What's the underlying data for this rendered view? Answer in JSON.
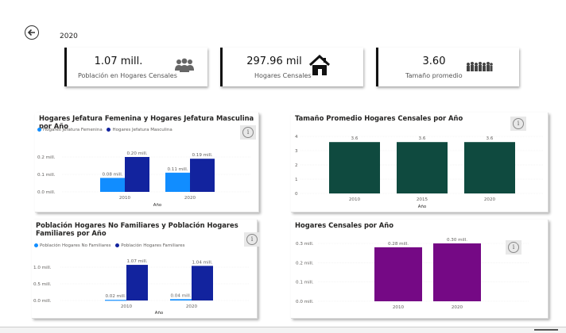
{
  "header": {
    "year": "2020"
  },
  "kpis": [
    {
      "value": "1.07 mill.",
      "label": "Población en Hogares Censales",
      "icon": "people-group-icon"
    },
    {
      "value": "297.96 mil",
      "label": "Hogares Censales",
      "icon": "house-icon"
    },
    {
      "value": "3.60",
      "label": "Tamaño promedio",
      "icon": "crowd-icon"
    }
  ],
  "chart_data": [
    {
      "type": "bar",
      "title": "Hogares Jefatura Femenina y Hogares Jefatura Masculina por Año",
      "xlabel": "Año",
      "categories": [
        "2010",
        "2020"
      ],
      "series": [
        {
          "name": "Hogares Jefatura Femenina",
          "values": [
            0.08,
            0.11
          ],
          "labels": [
            "0.08 mill.",
            "0.11 mill."
          ],
          "color": "#118dff"
        },
        {
          "name": "Hogares Jefatura Masculina",
          "values": [
            0.2,
            0.19
          ],
          "labels": [
            "0.20 mill.",
            "0.19 mill."
          ],
          "color": "#12239e"
        }
      ],
      "yticks": [
        "0.0 mill.",
        "0.1 mill.",
        "0.2 mill."
      ],
      "ylim": [
        0,
        0.2
      ]
    },
    {
      "type": "bar",
      "title": "Tamaño Promedio Hogares Censales por Año",
      "xlabel": "Año",
      "categories": [
        "2010",
        "2015",
        "2020"
      ],
      "series": [
        {
          "values": [
            3.6,
            3.6,
            3.6
          ],
          "labels": [
            "3.6",
            "3.6",
            "3.6"
          ],
          "color": "#0f4a3f"
        }
      ],
      "yticks": [
        "0",
        "1",
        "2",
        "3",
        "4"
      ],
      "ylim": [
        0,
        4
      ]
    },
    {
      "type": "bar",
      "title": "Población Hogares No Familiares y Población Hogares Familiares por Año",
      "xlabel": "Año",
      "categories": [
        "2010",
        "2020"
      ],
      "series": [
        {
          "name": "Población Hogares No Familiares",
          "values": [
            0.02,
            0.04
          ],
          "labels": [
            "0.02 mill.",
            "0.04 mill."
          ],
          "color": "#118dff"
        },
        {
          "name": "Población Hogares Familiares",
          "values": [
            1.07,
            1.04
          ],
          "labels": [
            "1.07 mill.",
            "1.04 mill."
          ],
          "color": "#12239e"
        }
      ],
      "yticks": [
        "0.0 mill.",
        "0.5 mill.",
        "1.0 mill."
      ],
      "ylim": [
        0,
        1.0
      ]
    },
    {
      "type": "bar",
      "title": "Hogares Censales por Año",
      "xlabel": "",
      "categories": [
        "2010",
        "2020"
      ],
      "series": [
        {
          "values": [
            0.28,
            0.3
          ],
          "labels": [
            "0.28 mill.",
            "0.30 mill."
          ],
          "color": "#750985"
        }
      ],
      "yticks": [
        "0.0 mill.",
        "0.1 mill.",
        "0.2 mill.",
        "0.3 mill."
      ],
      "ylim": [
        0,
        0.3
      ]
    }
  ]
}
